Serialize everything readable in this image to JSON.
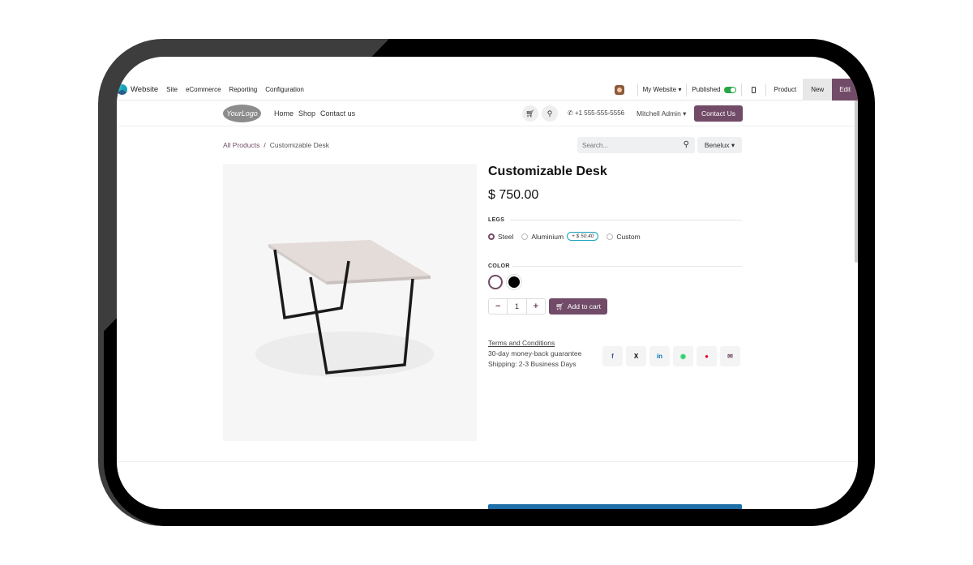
{
  "adminbar": {
    "app_name": "Website",
    "menu": [
      "Site",
      "eCommerce",
      "Reporting",
      "Configuration"
    ],
    "website_selector": "My Website ▾",
    "published_label": "Published",
    "product_label": "Product",
    "new_label": "New",
    "edit_label": "Edit"
  },
  "header": {
    "logo_text": "YourLogo",
    "nav": [
      "Home",
      "Shop",
      "Contact us"
    ],
    "phone": "+1 555-555-5556",
    "user": "Mitchell Admin ▾",
    "contact_button": "Contact Us"
  },
  "breadcrumb": {
    "parent": "All Products",
    "separator": "/",
    "current": "Customizable Desk"
  },
  "search": {
    "placeholder": "Search..."
  },
  "pricelist": "Benelux ▾",
  "product": {
    "name": "Customizable Desk",
    "price": "$ 750.00",
    "legs_label": "LEGS",
    "legs_options": [
      "Steel",
      "Aluminium",
      "Custom"
    ],
    "aluminium_extra": "+ $ 50.40",
    "selected_leg": "Steel",
    "color_label": "COLOR",
    "colors": [
      "#ffffff",
      "#000000"
    ],
    "selected_color": "#ffffff",
    "quantity": "1",
    "qty_minus": "−",
    "qty_plus": "+",
    "add_to_cart": "Add to cart",
    "terms_link": "Terms and Conditions",
    "guarantee": "30-day money-back guarantee",
    "shipping": "Shipping: 2-3 Business Days"
  },
  "share_icons": [
    {
      "name": "facebook-icon",
      "glyph": "f",
      "color": "#3b5998"
    },
    {
      "name": "x-icon",
      "glyph": "X",
      "color": "#000000"
    },
    {
      "name": "linkedin-icon",
      "glyph": "in",
      "color": "#0077b5"
    },
    {
      "name": "whatsapp-icon",
      "glyph": "◉",
      "color": "#25d366"
    },
    {
      "name": "pinterest-icon",
      "glyph": "●",
      "color": "#e60023"
    },
    {
      "name": "email-icon",
      "glyph": "✉",
      "color": "#714b67"
    }
  ],
  "colors": {
    "brand": "#714b67",
    "published_toggle": "#28a745"
  }
}
